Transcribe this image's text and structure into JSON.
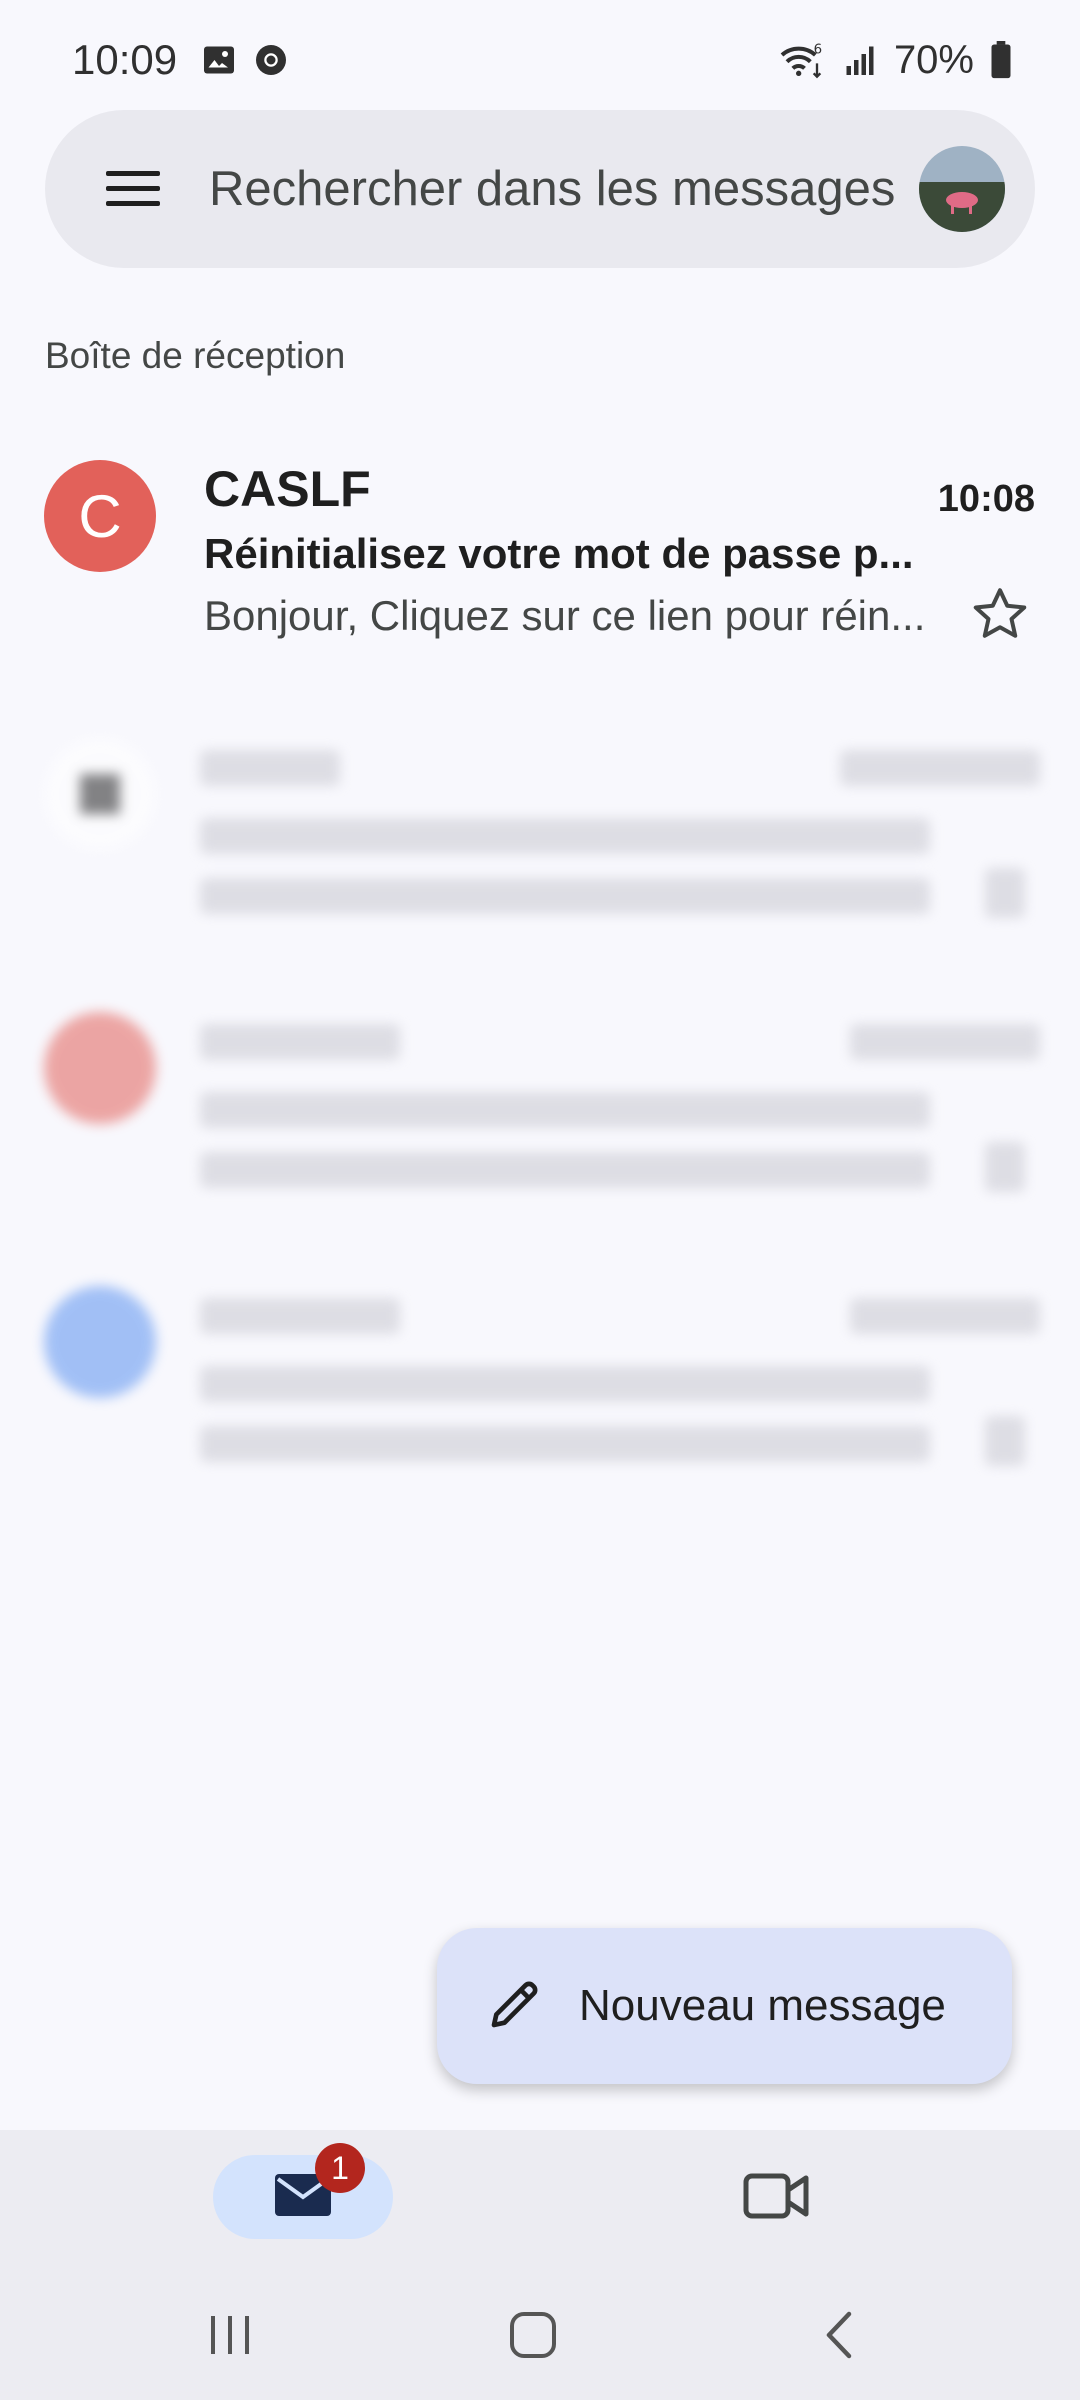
{
  "status_bar": {
    "time": "10:09",
    "battery": "70%",
    "icons": [
      "gallery-icon",
      "chrome-icon",
      "wifi-6-icon",
      "signal-icon",
      "battery-icon"
    ]
  },
  "search": {
    "placeholder": "Rechercher dans les messages"
  },
  "section_label": "Boîte de réception",
  "emails": [
    {
      "avatar_letter": "C",
      "avatar_color": "#e2615a",
      "sender": "CASLF",
      "time": "10:08",
      "subject": "Réinitialisez votre mot de passe p...",
      "snippet": "Bonjour, Cliquez sur ce lien pour réin...",
      "unread": true
    }
  ],
  "blurred_avatar_colors": [
    "#ffffff",
    "#e2615a",
    "#5b92f0"
  ],
  "fab": {
    "label": "Nouveau message"
  },
  "bottom_nav": {
    "mail_badge": "1"
  },
  "colors": {
    "background": "#f8f8fd",
    "search_bg": "#e9e9ef",
    "fab_bg": "#dce2f9",
    "nav_active": "#d3e3fd",
    "badge": "#b3261e"
  }
}
